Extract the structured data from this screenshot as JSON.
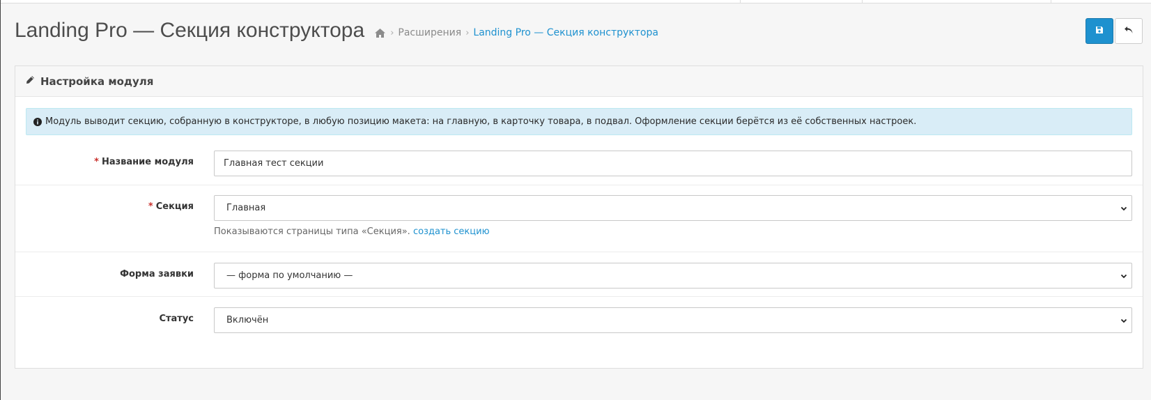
{
  "header": {
    "title": "Landing Pro — Секция конструктора",
    "breadcrumb": {
      "home_icon": "home-icon",
      "items": [
        "Расширения",
        "Landing Pro — Секция конструктора"
      ]
    }
  },
  "toolbar": {
    "save_icon": "save-icon",
    "back_icon": "reply-icon",
    "accent": "#1e91cf"
  },
  "panel": {
    "icon": "pencil-icon",
    "title": "Настройка модуля"
  },
  "alert": {
    "icon": "info-circle-icon",
    "text": "Модуль выводит секцию, собранную в конструкторе, в любую позицию макета: на главную, в карточку товара, в подвал. Оформление секции берётся из её собственных настроек."
  },
  "form": {
    "required_mark": "*",
    "module_name": {
      "label": "Название модуля",
      "value": "Главная тест секции",
      "required": true
    },
    "section": {
      "label": "Секция",
      "value": "Главная",
      "required": true,
      "help_text": "Показываются страницы типа «Секция».",
      "help_link": "создать секцию"
    },
    "request_form": {
      "label": "Форма заявки",
      "value": "— форма по умолчанию —",
      "required": false
    },
    "status": {
      "label": "Статус",
      "value": "Включён",
      "required": false
    }
  }
}
